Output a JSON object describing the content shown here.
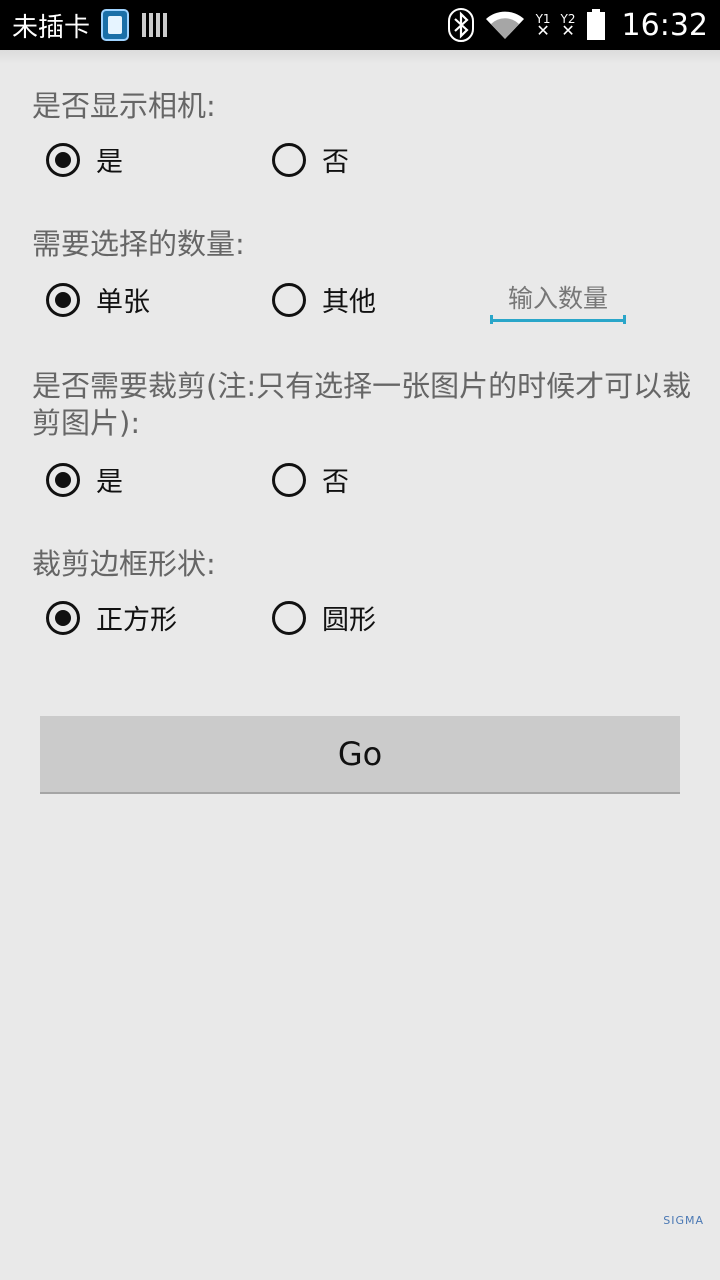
{
  "status_bar": {
    "carrier": "未插卡",
    "sim1": "1",
    "sim2": "2",
    "time": "16:32"
  },
  "form": {
    "show_camera": {
      "label": "是否显示相机:",
      "options": [
        "是",
        "否"
      ],
      "selected": "是"
    },
    "select_count": {
      "label": "需要选择的数量:",
      "options": [
        "单张",
        "其他"
      ],
      "selected": "单张",
      "input_placeholder": "输入数量",
      "input_value": ""
    },
    "crop": {
      "label": "是否需要裁剪(注:只有选择一张图片的时候才可以裁剪图片):",
      "options": [
        "是",
        "否"
      ],
      "selected": "是"
    },
    "crop_shape": {
      "label": "裁剪边框形状:",
      "options": [
        "正方形",
        "圆形"
      ],
      "selected": "正方形"
    },
    "go_label": "Go"
  },
  "watermark": "SIGMA",
  "colors": {
    "background": "#e9e9e9",
    "input_underline": "#2aa6c9",
    "button": "#cbcbcb"
  }
}
